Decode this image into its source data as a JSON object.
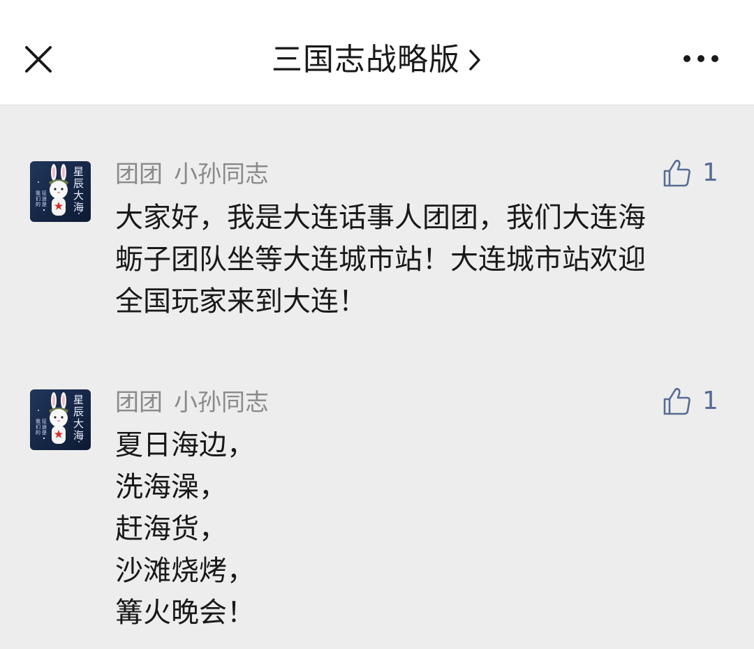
{
  "header": {
    "title": "三国志战略版",
    "close_icon": "close-icon",
    "chevron_icon": "chevron-right-icon",
    "more_icon": "more-horizontal-icon"
  },
  "comments": [
    {
      "author": "团团",
      "nickname": "小孙同志",
      "likes": "1",
      "avatar_text": "星辰大海",
      "avatar_text_small": "我们的征途是",
      "lines": [
        "大家好，我是大连话事人团团，我们大连海",
        "蛎子团队坐等大连城市站！大连城市站欢迎",
        "全国玩家来到大连！"
      ]
    },
    {
      "author": "团团",
      "nickname": "小孙同志",
      "likes": "1",
      "avatar_text": "星辰大海",
      "avatar_text_small": "我们的征途是",
      "lines": [
        "夏日海边，",
        "洗海澡，",
        "赶海货，",
        "沙滩烧烤，",
        "篝火晚会！"
      ]
    }
  ],
  "colors": {
    "background": "#ededed",
    "header_bg": "#ffffff",
    "meta_text": "#8a8a8a",
    "like_blue": "#576b95",
    "body_text": "#191919"
  }
}
